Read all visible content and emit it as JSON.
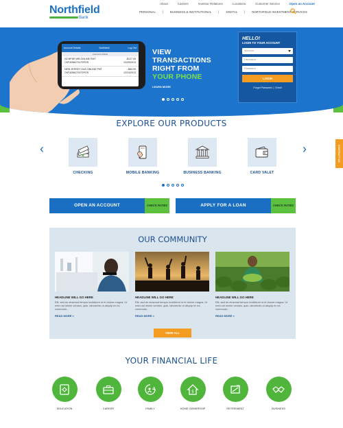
{
  "header": {
    "logo_name": "Northfield",
    "logo_sub": "Bank",
    "top_links": [
      "About",
      "Careers",
      "Investor Relations",
      "Locations",
      "Customer Service"
    ],
    "open_account": "Open an Account",
    "nav": [
      "PERSONAL",
      "BUSINESS & INSTITUTIONAL",
      "DIGITAL",
      "NORTHFIELD INVESTMENT SERVICES"
    ]
  },
  "hero": {
    "line1": "VIEW",
    "line2": "TRANSACTIONS",
    "line3": "RIGHT FROM",
    "line4": "YOUR PHONE",
    "learn_more": "LEARN MORE",
    "phone": {
      "left_tab": "Account Details",
      "logo": "Northfield",
      "right_tab": "Log Out",
      "subtab": "Checkout Mobile",
      "rows": [
        {
          "desc": "NJ MFDR WB ONLINE PMT CKF425847247SPOS",
          "amount": "-$127.00",
          "date": "12/29/2013"
        },
        {
          "desc": "NEW JERSEY GAS ONLINE PMT CKF425847247SPOS",
          "amount": "-$84.00",
          "date": "12/24/2013"
        }
      ]
    }
  },
  "login": {
    "hello": "HELLO!",
    "subtitle": "LOGIN TO YOUR ACCOUNT",
    "account_select": "Account",
    "username_placeholder": "Username",
    "password_placeholder": "Password",
    "button": "LOGIN",
    "forgot": "Forgot Password",
    "enroll": "Enroll"
  },
  "products": {
    "title": "EXPLORE OUR PRODUCTS",
    "items": [
      "CHECKING",
      "MOBILE BANKING",
      "BUSINESS BANKING",
      "CARD VALET"
    ],
    "side_tab": "CONTACT US"
  },
  "cta": {
    "open_account": "OPEN AN ACCOUNT",
    "apply_loan": "APPLY FOR A LOAN",
    "check_rates": "CHECK RATES"
  },
  "community": {
    "title": "OUR COMMUNITY",
    "cards": [
      {
        "headline": "HEADLINE WILL GO HERE",
        "body": "Elit, sed do eiusmod tempor incididunt ut et dolore magna. Ut enim ad minim veniam, quis. laboremis ut aliquip ex ea commodo...",
        "more": "READ MORE >"
      },
      {
        "headline": "HEADLINE WILL GO HERE",
        "body": "Elit, sed do eiusmod tempor incididunt ut et dolore magna. Ut enim ad minim veniam, quis. laboremis ut aliquip ex ea commodo...",
        "more": "READ MORE >"
      },
      {
        "headline": "HEADLINE WILL GO HERE",
        "body": "Elit, sed do eiusmod tempor incididunt ut et dolore magna. Ut enim ad minim veniam, quis. laboremis ut aliquip ex ea commodo...",
        "more": "READ MORE >"
      }
    ],
    "view_all": "VIEW ALL"
  },
  "financial": {
    "title": "YOUR FINANCIAL LIFE",
    "items": [
      "EDUCATION",
      "CAREER",
      "FAMILY",
      "HOME OWNERSHIP",
      "RETIREMENT",
      "BUSINESS"
    ]
  },
  "colors": {
    "brand_blue": "#1b6fc2",
    "brand_green": "#5cc13f",
    "accent_orange": "#f39c1f"
  }
}
